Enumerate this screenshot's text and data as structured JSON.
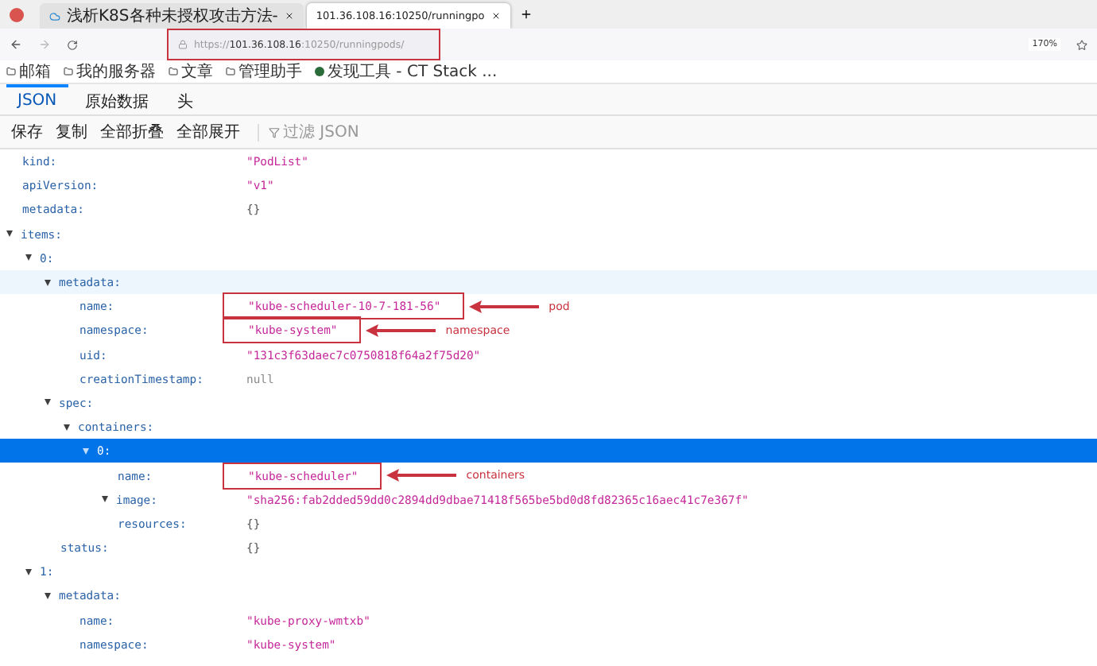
{
  "browser_tabs": [
    {
      "title": "浅析K8S各种未授权攻击方法-",
      "selected": false
    },
    {
      "title": "101.36.108.16:10250/runningpo",
      "selected": true
    }
  ],
  "address_bar": {
    "scheme": "https://",
    "host": "101.36.108.16",
    "rest": ":10250/runningpods/",
    "boxed": true
  },
  "zoom": "170%",
  "bookmarks": [
    {
      "label": "邮箱",
      "kind": "folder"
    },
    {
      "label": "我的服务器",
      "kind": "folder"
    },
    {
      "label": "文章",
      "kind": "folder"
    },
    {
      "label": "管理助手",
      "kind": "folder"
    },
    {
      "label": "发现工具 - CT Stack ...",
      "kind": "site"
    }
  ],
  "viewer_tabs": [
    {
      "label": "JSON",
      "selected": true
    },
    {
      "label": "原始数据",
      "selected": false
    },
    {
      "label": "头",
      "selected": false
    }
  ],
  "toolbar": [
    "保存",
    "复制",
    "全部折叠",
    "全部展开"
  ],
  "filter": {
    "placeholder": "过滤 JSON"
  },
  "tree": [
    {
      "key": "kind:",
      "value": "\"PodList\"",
      "kind": "string",
      "selected": false,
      "hovered": false
    },
    {
      "key": "apiVersion:",
      "value": "\"v1\"",
      "kind": "string",
      "selected": false,
      "hovered": false
    },
    {
      "key": "metadata:",
      "value": "{}",
      "kind": "object",
      "selected": false,
      "hovered": false
    },
    {
      "key": "items:",
      "expanded": true,
      "selected": false,
      "hovered": false,
      "children": [
        {
          "key": "0:",
          "expanded": true,
          "selected": false,
          "hovered": false,
          "children": [
            {
              "key": "metadata:",
              "expanded": true,
              "selected": false,
              "hovered": true,
              "children": [
                {
                  "key": "name:",
                  "value": "\"kube-scheduler-10-7-181-56\"",
                  "kind": "string",
                  "selected": false,
                  "hovered": false,
                  "boxed": true,
                  "annotation": "pod"
                },
                {
                  "key": "namespace:",
                  "value": "\"kube-system\"",
                  "kind": "string",
                  "selected": false,
                  "hovered": false,
                  "boxed": true,
                  "annotation": "namespace"
                },
                {
                  "key": "uid:",
                  "value": "\"131c3f63daec7c0750818f64a2f75d20\"",
                  "kind": "string",
                  "selected": false,
                  "hovered": false
                },
                {
                  "key": "creationTimestamp:",
                  "value": "null",
                  "kind": "null",
                  "selected": false,
                  "hovered": false
                }
              ]
            },
            {
              "key": "spec:",
              "expanded": true,
              "selected": false,
              "hovered": false,
              "children": [
                {
                  "key": "containers:",
                  "expanded": true,
                  "selected": false,
                  "hovered": false,
                  "children": [
                    {
                      "key": "0:",
                      "expanded": true,
                      "selected": true,
                      "hovered": false,
                      "children": [
                        {
                          "key": "name:",
                          "value": "\"kube-scheduler\"",
                          "kind": "string",
                          "selected": false,
                          "hovered": false,
                          "boxed": true,
                          "annotation": "containers"
                        },
                        {
                          "key": "image:",
                          "value": "\"sha256:fab2dded59dd0c2894dd9dbae71418f565be5bd0d8fd82365c16aec41c7e367f\"",
                          "kind": "string",
                          "expanded": true,
                          "selected": false,
                          "hovered": false
                        },
                        {
                          "key": "resources:",
                          "value": "{}",
                          "kind": "object",
                          "selected": false,
                          "hovered": false
                        }
                      ]
                    }
                  ]
                }
              ]
            },
            {
              "key": "status:",
              "value": "{}",
              "kind": "object",
              "selected": false,
              "hovered": false
            }
          ]
        },
        {
          "key": "1:",
          "expanded": true,
          "selected": false,
          "hovered": false,
          "children": [
            {
              "key": "metadata:",
              "expanded": true,
              "selected": false,
              "hovered": false,
              "children": [
                {
                  "key": "name:",
                  "value": "\"kube-proxy-wmtxb\"",
                  "kind": "string",
                  "selected": false,
                  "hovered": false
                },
                {
                  "key": "namespace:",
                  "value": "\"kube-system\"",
                  "kind": "string",
                  "selected": false,
                  "hovered": false
                }
              ]
            }
          ]
        }
      ]
    }
  ]
}
